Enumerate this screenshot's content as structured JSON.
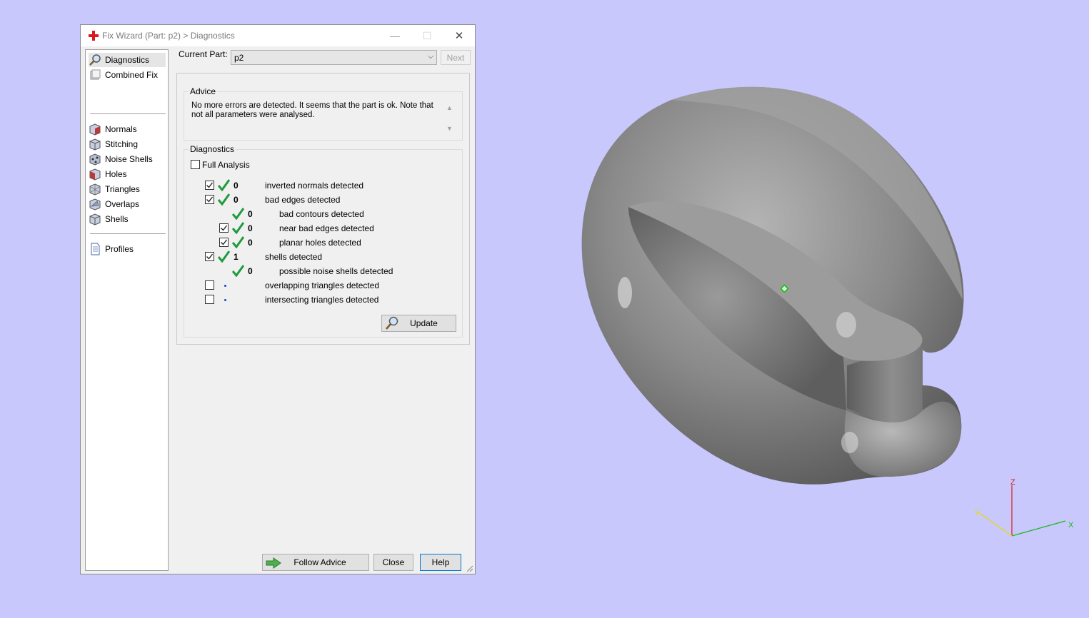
{
  "window": {
    "title": "Fix Wizard (Part: p2) > Diagnostics",
    "minimize_glyph": "—",
    "maximize_glyph": "☐",
    "close_glyph": "✕"
  },
  "sidebar": {
    "items": [
      {
        "label": "Diagnostics",
        "icon": "magnifier-icon"
      },
      {
        "label": "Combined Fix",
        "icon": "combined-fix-icon"
      },
      {
        "label": "Normals",
        "icon": "normals-cube-icon"
      },
      {
        "label": "Stitching",
        "icon": "stitching-cube-icon"
      },
      {
        "label": "Noise Shells",
        "icon": "noise-shells-cube-icon"
      },
      {
        "label": "Holes",
        "icon": "holes-cube-icon"
      },
      {
        "label": "Triangles",
        "icon": "triangles-cube-icon"
      },
      {
        "label": "Overlaps",
        "icon": "overlaps-cube-icon"
      },
      {
        "label": "Shells",
        "icon": "shells-cube-icon"
      },
      {
        "label": "Profiles",
        "icon": "profiles-document-icon"
      }
    ]
  },
  "header": {
    "current_part_label": "Current Part:",
    "current_part_value": "p2",
    "next_label": "Next"
  },
  "advice": {
    "title": "Advice",
    "text": "No more errors are detected. It seems that the part is ok. Note that not all parameters were analysed."
  },
  "diagnostics": {
    "title": "Diagnostics",
    "full_analysis_label": "Full Analysis",
    "rows": [
      {
        "checked": true,
        "status": "ok",
        "count": "0",
        "label": "inverted normals detected"
      },
      {
        "checked": true,
        "status": "ok",
        "count": "0",
        "label": "bad edges detected"
      },
      {
        "checked": null,
        "status": "ok",
        "count": "0",
        "label": "bad contours detected"
      },
      {
        "checked": true,
        "status": "ok",
        "count": "0",
        "label": "near bad edges detected"
      },
      {
        "checked": true,
        "status": "ok",
        "count": "0",
        "label": "planar holes detected"
      },
      {
        "checked": true,
        "status": "ok",
        "count": "1",
        "label": "shells detected"
      },
      {
        "checked": null,
        "status": "ok",
        "count": "0",
        "label": "possible noise shells detected"
      },
      {
        "checked": false,
        "status": "none",
        "count": "",
        "label": "overlapping triangles detected"
      },
      {
        "checked": false,
        "status": "none",
        "count": "",
        "label": "intersecting triangles detected"
      }
    ],
    "update_label": "Update"
  },
  "footer": {
    "follow_advice_label": "Follow Advice",
    "close_label": "Close",
    "help_label": "Help"
  },
  "viewport": {
    "background": "#c9c8fd",
    "axis_labels": {
      "x": "X",
      "y": "Y",
      "z": "Z"
    },
    "axis_colors": {
      "x": "#1bb81b",
      "y": "#e8d800",
      "z": "#d81a1a"
    }
  },
  "colors": {
    "check_green": "#1e9b3c",
    "dot_blue": "#1a3fd6",
    "title_icon_red": "#d81a1a"
  }
}
